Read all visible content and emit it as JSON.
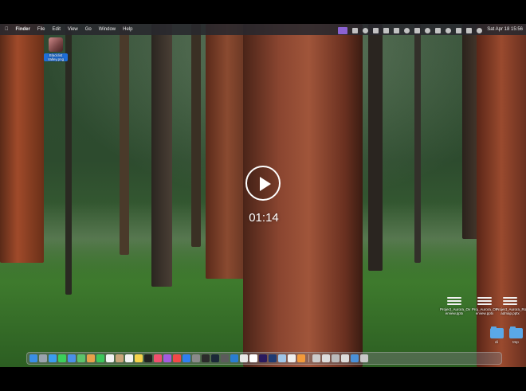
{
  "menubar": {
    "app_name": "Finder",
    "menus": [
      "File",
      "Edit",
      "View",
      "Go",
      "Window",
      "Help"
    ],
    "clock": "Sat Apr 18  15:56"
  },
  "desktop": {
    "photo_icon": {
      "label": "Blacklist Valley.png"
    },
    "files": [
      {
        "label": "Project_Aurora_Overview.pptx",
        "icon": "presentation-icon"
      },
      {
        "label": "Project_Aurora_Overview.pptx",
        "icon": "presentation-icon"
      },
      {
        "label": "Project_Aurora_Roadmap.pptx",
        "icon": "presentation-icon"
      }
    ],
    "file_labels_shown": [
      "Project_Aurora_Ov erview.pptx",
      "Proj_Aurora_Ov erview.pptx",
      "Project_Aurora_Ro admap.pptx"
    ],
    "folders": [
      {
        "label": "cli",
        "icon": "folder-icon"
      },
      {
        "label": "tmp",
        "icon": "folder-icon"
      }
    ]
  },
  "video_overlay": {
    "timecode": "01:14",
    "play_icon": "play-icon"
  },
  "dock": {
    "items": [
      "finder",
      "launchpad",
      "safari",
      "messages",
      "mail",
      "maps",
      "photos",
      "facetime",
      "calendar",
      "contacts",
      "reminders",
      "notes",
      "tv",
      "music",
      "podcasts",
      "news",
      "app-store",
      "settings",
      "terminal",
      "steam",
      "calculator",
      "vscode",
      "chrome",
      "notion",
      "premiere",
      "photoshop",
      "preview",
      "textedit",
      "pages",
      "finder-window",
      "window-2",
      "window-3",
      "window-4",
      "downloads",
      "trash"
    ],
    "colors": [
      "#3a8ee6",
      "#9aa3ad",
      "#3b9cf0",
      "#3ccf5a",
      "#4a8fe8",
      "#5cc36b",
      "#e8a04a",
      "#3cc65a",
      "#f2f2f2",
      "#c9a57a",
      "#f2f2f2",
      "#f5d24a",
      "#222222",
      "#f0506e",
      "#a35be0",
      "#f24848",
      "#2f7ff0",
      "#8a8a8a",
      "#2b2b2b",
      "#1b2838",
      "#5b5b5b",
      "#2a7dd1",
      "#e8e8e8",
      "#ffffff",
      "#2a1a5e",
      "#1f3b73",
      "#9fc5e8",
      "#eeeeee",
      "#f29a3a",
      "#cccccc",
      "#dddddd",
      "#bbbbbb",
      "#dddddd",
      "#4a90d9",
      "#c8c8c8"
    ]
  }
}
